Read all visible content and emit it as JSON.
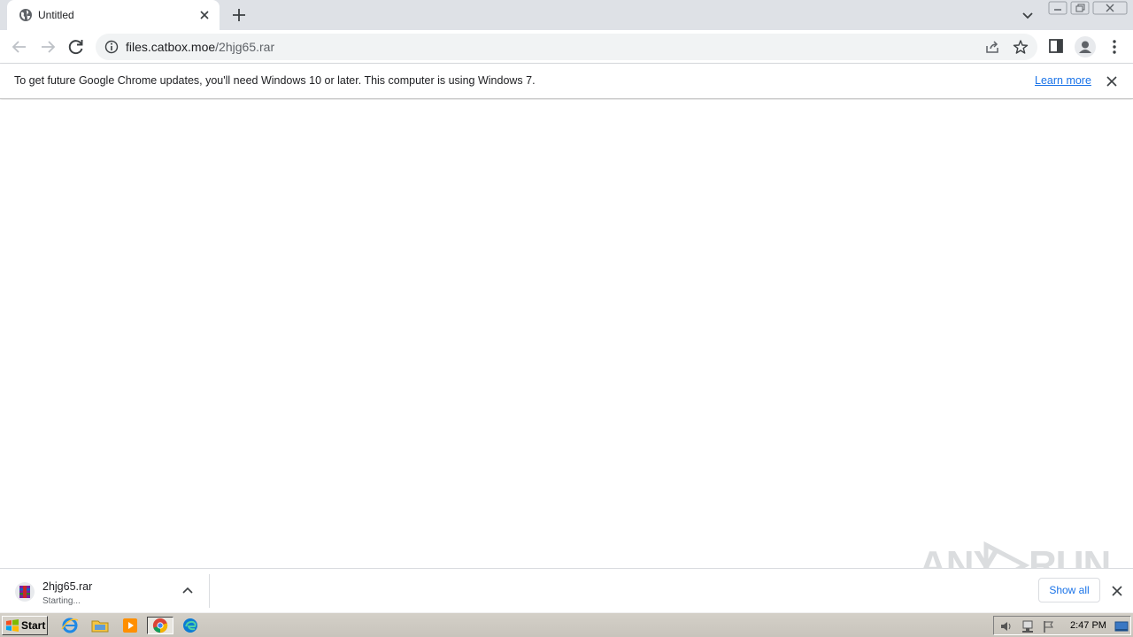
{
  "tab": {
    "title": "Untitled"
  },
  "omnibox": {
    "host": "files.catbox.moe",
    "path": "/2hjg65.rar"
  },
  "infobar": {
    "message": "To get future Google Chrome updates, you'll need Windows 10 or later. This computer is using Windows 7.",
    "link": "Learn more"
  },
  "download": {
    "filename": "2hjg65.rar",
    "status": "Starting..."
  },
  "shelf": {
    "show_all": "Show all"
  },
  "watermark": {
    "text_left": "ANY",
    "text_right": "RUN"
  },
  "taskbar": {
    "start_label": "Start",
    "clock": "2:47 PM"
  },
  "icons": [
    "globe-icon",
    "close-icon",
    "plus-icon",
    "chevron-down-icon",
    "minimize-icon",
    "maximize-icon",
    "window-close-icon",
    "back-arrow-icon",
    "forward-arrow-icon",
    "reload-icon",
    "info-icon",
    "share-icon",
    "star-icon",
    "side-panel-icon",
    "profile-icon",
    "kebab-menu-icon",
    "winrar-icon",
    "chevron-up-icon",
    "windows-flag-icon",
    "ie-icon",
    "folder-icon",
    "media-player-icon",
    "chrome-icon",
    "edge-icon",
    "speaker-icon",
    "network-icon",
    "action-center-flag-icon",
    "show-desktop-icon"
  ],
  "colors": {
    "tabstrip": "#dee1e6",
    "link": "#1a73e8",
    "taskbar": "#d4d0c8"
  }
}
